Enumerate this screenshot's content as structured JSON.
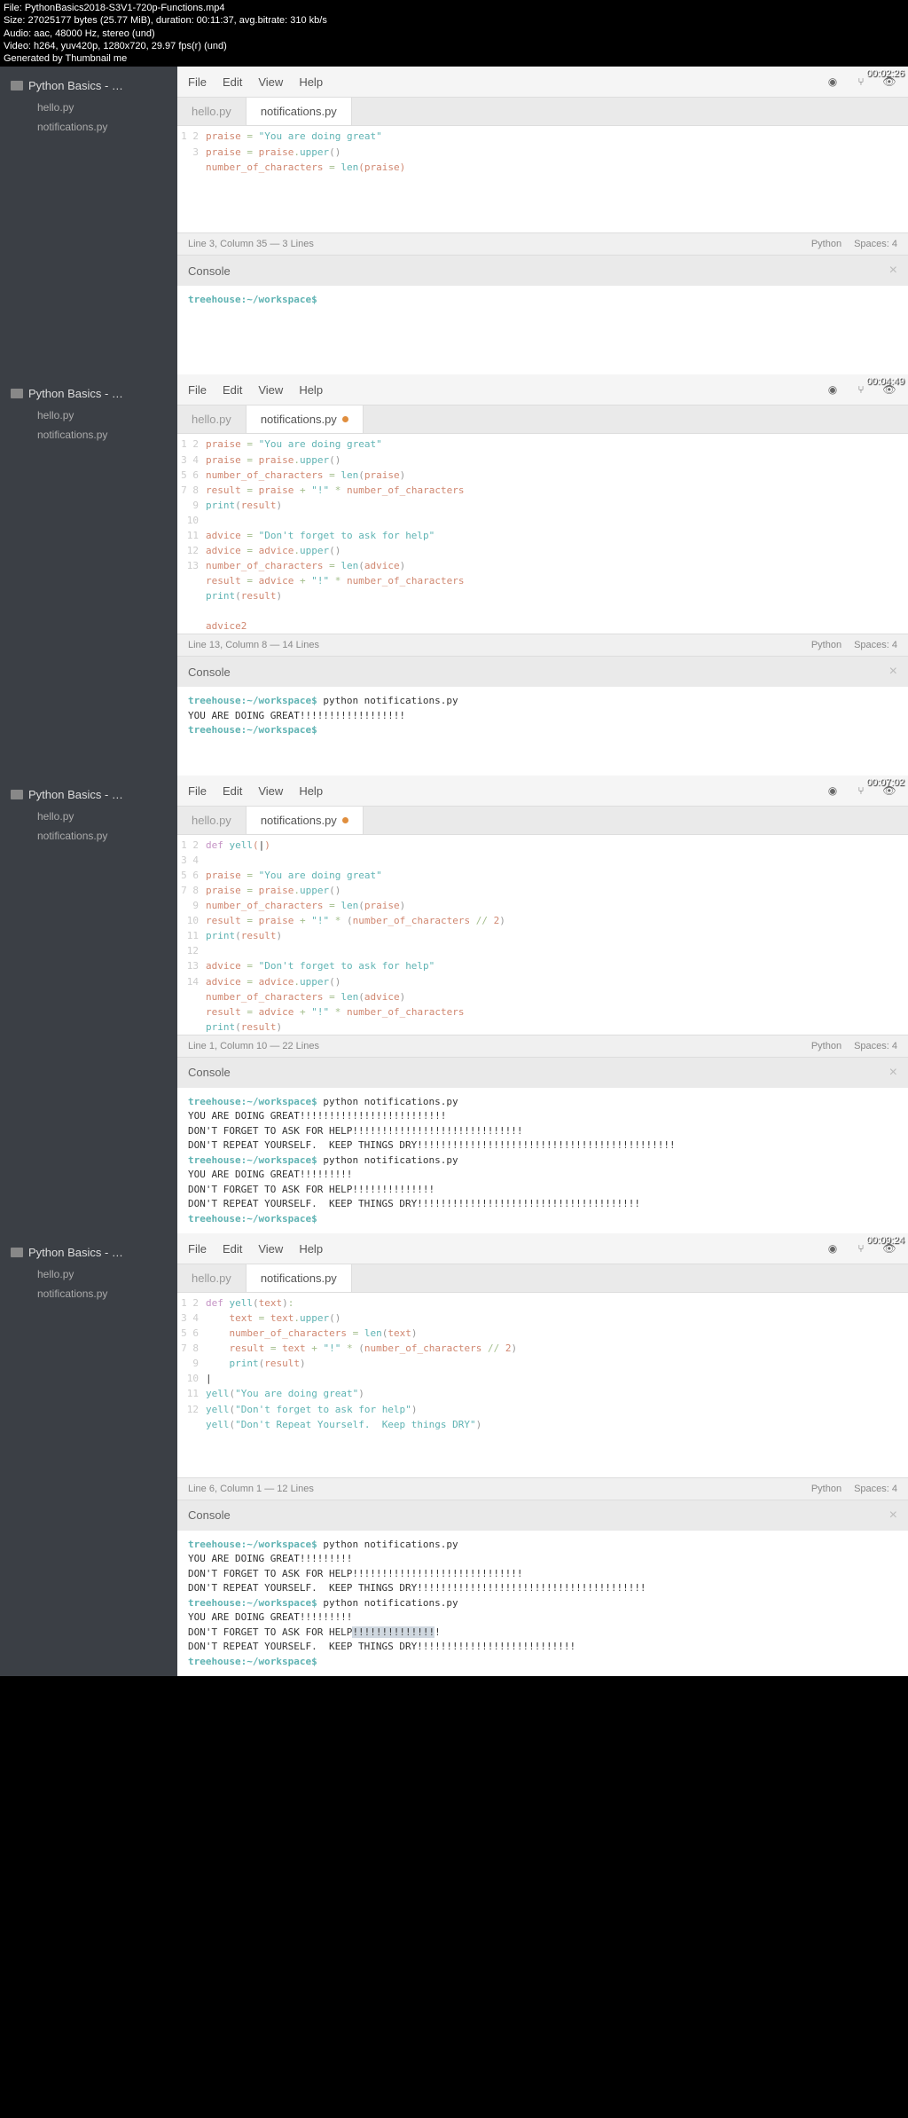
{
  "header": {
    "file": "File: PythonBasics2018-S3V1-720p-Functions.mp4",
    "size": "Size: 27025177 bytes (25.77 MiB), duration: 00:11:37, avg.bitrate: 310 kb/s",
    "audio": "Audio: aac, 48000 Hz, stereo (und)",
    "video": "Video: h264, yuv420p, 1280x720, 29.97 fps(r) (und)",
    "generated": "Generated by Thumbnail me"
  },
  "menu": {
    "file": "File",
    "edit": "Edit",
    "view": "View",
    "help": "Help"
  },
  "sidebar": {
    "folder": "Python Basics - …",
    "f1": "hello.py",
    "f2": "notifications.py"
  },
  "tabs": {
    "t1": "hello.py",
    "t2": "notifications.py"
  },
  "console_label": "Console",
  "lang": "Python",
  "spaces": "Spaces: 4",
  "s1": {
    "timestamp": "00:02:26",
    "status": "Line 3, Column 35 — 3 Lines",
    "prompt": "treehouse:~/workspace$"
  },
  "s2": {
    "timestamp": "00:04:49",
    "status": "Line 13, Column 8 — 14 Lines",
    "cmd": " python notifications.py",
    "out": "YOU ARE DOING GREAT!!!!!!!!!!!!!!!!!!",
    "prompt": "treehouse:~/workspace$"
  },
  "s3": {
    "timestamp": "00:07:02",
    "status": "Line 1, Column 10 — 22 Lines",
    "cmd": " python notifications.py",
    "o1": "YOU ARE DOING GREAT!!!!!!!!!!!!!!!!!!!!!!!!!",
    "o2": "DON'T FORGET TO ASK FOR HELP!!!!!!!!!!!!!!!!!!!!!!!!!!!!!",
    "o3": "DON'T REPEAT YOURSELF.  KEEP THINGS DRY!!!!!!!!!!!!!!!!!!!!!!!!!!!!!!!!!!!!!!!!!!!!",
    "o4": "YOU ARE DOING GREAT!!!!!!!!!",
    "o5": "DON'T FORGET TO ASK FOR HELP!!!!!!!!!!!!!!",
    "o6": "DON'T REPEAT YOURSELF.  KEEP THINGS DRY!!!!!!!!!!!!!!!!!!!!!!!!!!!!!!!!!!!!!!",
    "prompt": "treehouse:~/workspace$"
  },
  "s4": {
    "timestamp": "00:09:24",
    "status": "Line 6, Column 1 — 12 Lines",
    "cmd": " python notifications.py",
    "o1": "YOU ARE DOING GREAT!!!!!!!!!",
    "o2": "DON'T FORGET TO ASK FOR HELP!!!!!!!!!!!!!!!!!!!!!!!!!!!!!",
    "o3": "DON'T REPEAT YOURSELF.  KEEP THINGS DRY!!!!!!!!!!!!!!!!!!!!!!!!!!!!!!!!!!!!!!!",
    "o4": "YOU ARE DOING GREAT!!!!!!!!!",
    "o5a": "DON'T FORGET TO ASK FOR HELP",
    "o5b": "!!!!!!!!!!!!!!",
    "o5c": "!",
    "o6": "DON'T REPEAT YOURSELF.  KEEP THINGS DRY!!!!!!!!!!!!!!!!!!!!!!!!!!!",
    "prompt": "treehouse:~/workspace$"
  }
}
